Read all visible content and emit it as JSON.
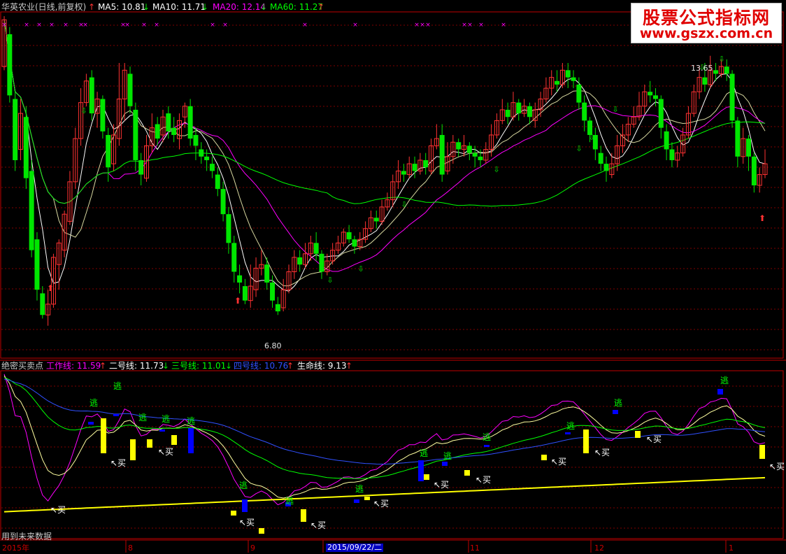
{
  "colors": {
    "up": "#ff3232",
    "down": "#00e600",
    "ma5": "#ffffff",
    "ma10": "#ffff00",
    "ma20": "#ff00ff",
    "ma60": "#00ff00",
    "grid": "#800000",
    "border": "#c00000",
    "blue": "#0000ff",
    "yellow": "#ffff00",
    "escape": "#00ff00"
  },
  "top_bar": {
    "title": "华英农业(日线,前复权)",
    "ma5": "MA5: 10.81",
    "ma10": "MA10: 11.71",
    "ma20": "MA20: 12.14",
    "ma60": "MA60: 11.27"
  },
  "bottom_bar": {
    "title": "绝密买卖点",
    "l1": "工作线: 11.59",
    "l2": "二号线: 11.73",
    "l3": "三号线: 11.01",
    "l4": "四号线: 10.76",
    "l5": "生命线: 9.13"
  },
  "arrows": {
    "up": "↑",
    "down": "↓"
  },
  "watermark": {
    "line1": "股票公式指标网",
    "line2": "www.gszx.com.cn"
  },
  "price_labels": {
    "high": "13.65",
    "low": "6.80"
  },
  "footer_note": "用到未来数据",
  "x_labels": [
    {
      "text": "2015年"
    },
    {
      "text": "8"
    },
    {
      "text": "9"
    },
    {
      "text": "2015/09/22/二"
    },
    {
      "text": "11"
    },
    {
      "text": "12"
    },
    {
      "text": "1"
    }
  ],
  "signal_text": {
    "escape": "逃",
    "buy": "买"
  },
  "chart_data": {
    "type": "candlestick",
    "top_axis": {
      "ylim": [
        5.4,
        15.0
      ],
      "grid": true
    },
    "bottom_axis": {
      "ylim": [
        5.5,
        15.5
      ],
      "grid": true
    },
    "candles": [
      [
        13.5,
        14.8,
        14.9,
        13.4
      ],
      [
        14.4,
        12.7,
        14.6,
        12.5
      ],
      [
        12.6,
        10.9,
        12.8,
        10.6
      ],
      [
        11.2,
        12.2,
        12.6,
        10.9
      ],
      [
        12.1,
        10.4,
        12.4,
        10.1
      ],
      [
        10.6,
        8.4,
        10.9,
        8.2
      ],
      [
        8.7,
        7.3,
        8.9,
        7.0
      ],
      [
        7.2,
        6.6,
        7.4,
        6.5
      ],
      [
        6.6,
        6.9,
        7.3,
        6.3
      ],
      [
        6.9,
        8.2,
        8.3,
        6.8
      ],
      [
        8.0,
        8.6,
        8.7,
        7.3
      ],
      [
        8.4,
        9.4,
        9.5,
        8.2
      ],
      [
        9.2,
        10.3,
        10.6,
        9.1
      ],
      [
        10.3,
        11.5,
        11.8,
        10.1
      ],
      [
        11.5,
        12.5,
        12.9,
        11.3
      ],
      [
        12.5,
        13.1,
        13.3,
        12.4
      ],
      [
        13.2,
        12.2,
        13.4,
        12.0
      ],
      [
        12.2,
        12.6,
        12.8,
        11.8
      ],
      [
        12.6,
        11.7,
        12.7,
        11.5
      ],
      [
        11.6,
        10.7,
        11.8,
        10.3
      ],
      [
        10.8,
        11.6,
        11.9,
        10.6
      ],
      [
        11.5,
        12.6,
        13.6,
        11.3
      ],
      [
        12.6,
        13.4,
        13.6,
        12.0
      ],
      [
        13.3,
        12.4,
        13.5,
        12.2
      ],
      [
        12.3,
        10.9,
        12.5,
        10.6
      ],
      [
        10.9,
        10.5,
        11.1,
        10.2
      ],
      [
        10.4,
        11.3,
        11.6,
        10.3
      ],
      [
        11.3,
        11.8,
        12.2,
        11.1
      ],
      [
        11.9,
        11.5,
        12.1,
        11.3
      ],
      [
        11.6,
        12.1,
        12.3,
        11.4
      ],
      [
        12.2,
        11.7,
        12.4,
        11.5
      ],
      [
        11.8,
        11.6,
        12.1,
        11.4
      ],
      [
        11.5,
        12.0,
        12.2,
        11.2
      ],
      [
        12.1,
        12.4,
        12.5,
        11.8
      ],
      [
        12.4,
        11.5,
        12.6,
        11.3
      ],
      [
        11.6,
        11.3,
        11.8,
        10.9
      ],
      [
        11.2,
        11.0,
        11.4,
        10.8
      ],
      [
        11.0,
        10.9,
        11.2,
        10.6
      ],
      [
        10.8,
        10.6,
        11.0,
        10.4
      ],
      [
        10.5,
        10.1,
        10.7,
        9.9
      ],
      [
        10.1,
        9.4,
        10.3,
        9.2
      ],
      [
        9.4,
        8.6,
        9.6,
        8.3
      ],
      [
        8.6,
        7.8,
        8.8,
        7.5
      ],
      [
        7.7,
        7.5,
        8.0,
        7.2
      ],
      [
        7.4,
        7.0,
        7.6,
        6.9
      ],
      [
        7.0,
        7.4,
        8.0,
        6.8
      ],
      [
        7.3,
        7.9,
        8.2,
        7.1
      ],
      [
        7.9,
        8.0,
        8.4,
        7.7
      ],
      [
        8.0,
        7.5,
        8.2,
        7.3
      ],
      [
        7.5,
        7.0,
        7.7,
        6.8
      ],
      [
        6.9,
        6.7,
        7.1,
        6.6
      ],
      [
        6.8,
        7.3,
        7.6,
        6.7
      ],
      [
        7.3,
        7.8,
        8.0,
        7.2
      ],
      [
        7.8,
        8.2,
        8.4,
        7.6
      ],
      [
        8.2,
        8.0,
        8.4,
        7.8
      ],
      [
        8.0,
        8.3,
        8.6,
        7.9
      ],
      [
        8.3,
        8.6,
        8.8,
        8.1
      ],
      [
        8.6,
        8.3,
        8.9,
        8.1
      ],
      [
        8.3,
        7.8,
        8.4,
        7.6
      ],
      [
        7.8,
        8.1,
        8.3,
        7.7
      ],
      [
        8.1,
        8.4,
        8.6,
        8.0
      ],
      [
        8.4,
        8.6,
        8.8,
        8.3
      ],
      [
        8.6,
        8.9,
        9.0,
        8.5
      ],
      [
        8.9,
        8.7,
        9.1,
        8.6
      ],
      [
        8.7,
        8.5,
        8.8,
        8.3
      ],
      [
        8.5,
        8.7,
        8.9,
        8.4
      ],
      [
        8.7,
        9.0,
        9.2,
        8.6
      ],
      [
        9.0,
        9.3,
        9.5,
        8.9
      ],
      [
        9.3,
        9.2,
        9.5,
        9.0
      ],
      [
        9.2,
        9.6,
        9.8,
        9.1
      ],
      [
        9.6,
        9.8,
        10.0,
        9.5
      ],
      [
        9.8,
        10.3,
        10.5,
        9.6
      ],
      [
        10.3,
        10.6,
        10.9,
        10.1
      ],
      [
        10.6,
        10.5,
        10.8,
        10.3
      ],
      [
        10.5,
        10.8,
        11.0,
        10.4
      ],
      [
        10.8,
        10.6,
        11.0,
        10.4
      ],
      [
        10.6,
        10.9,
        11.1,
        10.5
      ],
      [
        10.9,
        10.7,
        11.1,
        10.5
      ],
      [
        10.6,
        11.3,
        11.5,
        10.5
      ],
      [
        11.3,
        11.5,
        11.9,
        11.2
      ],
      [
        11.6,
        10.5,
        11.9,
        10.3
      ],
      [
        10.6,
        11.0,
        11.4,
        10.5
      ],
      [
        11.0,
        11.4,
        11.6,
        10.8
      ],
      [
        11.4,
        11.2,
        11.5,
        11.0
      ],
      [
        11.2,
        11.3,
        11.6,
        11.0
      ],
      [
        11.3,
        11.1,
        11.4,
        10.9
      ],
      [
        11.1,
        11.0,
        11.3,
        10.7
      ],
      [
        11.0,
        10.9,
        11.2,
        10.7
      ],
      [
        10.9,
        11.2,
        11.4,
        10.8
      ],
      [
        11.2,
        11.6,
        11.9,
        11.0
      ],
      [
        11.6,
        12.0,
        12.2,
        11.5
      ],
      [
        12.0,
        12.3,
        12.6,
        11.9
      ],
      [
        12.3,
        12.1,
        12.5,
        11.9
      ],
      [
        12.1,
        12.5,
        12.8,
        12.0
      ],
      [
        12.5,
        12.2,
        12.6,
        12.0
      ],
      [
        12.2,
        12.4,
        12.6,
        12.1
      ],
      [
        12.4,
        12.1,
        12.5,
        11.9
      ],
      [
        12.0,
        12.3,
        12.5,
        11.8
      ],
      [
        12.3,
        12.6,
        12.8,
        12.1
      ],
      [
        12.6,
        12.9,
        13.2,
        12.5
      ],
      [
        12.9,
        13.2,
        13.4,
        12.7
      ],
      [
        13.1,
        13.0,
        13.4,
        12.8
      ],
      [
        13.0,
        13.4,
        13.6,
        12.9
      ],
      [
        13.4,
        13.2,
        13.6,
        12.9
      ],
      [
        13.2,
        13.1,
        13.4,
        12.9
      ],
      [
        13.0,
        12.5,
        13.2,
        12.3
      ],
      [
        12.5,
        12.0,
        12.7,
        11.7
      ],
      [
        12.0,
        11.6,
        12.1,
        11.4
      ],
      [
        11.6,
        11.2,
        11.8,
        10.9
      ],
      [
        11.1,
        10.8,
        11.3,
        10.6
      ],
      [
        10.8,
        10.6,
        11.0,
        10.3
      ],
      [
        10.5,
        10.8,
        11.1,
        10.4
      ],
      [
        10.8,
        11.3,
        11.6,
        10.6
      ],
      [
        11.3,
        11.6,
        11.9,
        11.1
      ],
      [
        11.6,
        11.9,
        12.1,
        11.4
      ],
      [
        11.9,
        12.1,
        12.4,
        11.8
      ],
      [
        12.1,
        12.4,
        12.8,
        12.0
      ],
      [
        12.4,
        12.8,
        13.0,
        12.2
      ],
      [
        12.8,
        12.7,
        13.1,
        12.5
      ],
      [
        12.7,
        12.6,
        12.9,
        12.4
      ],
      [
        12.6,
        11.8,
        12.7,
        11.5
      ],
      [
        11.7,
        11.2,
        11.9,
        10.9
      ],
      [
        11.2,
        10.9,
        11.4,
        10.7
      ],
      [
        10.9,
        11.1,
        11.3,
        10.7
      ],
      [
        11.1,
        11.6,
        11.8,
        11.0
      ],
      [
        11.6,
        12.2,
        12.4,
        11.5
      ],
      [
        12.2,
        12.8,
        13.0,
        12.1
      ],
      [
        12.8,
        13.2,
        13.5,
        12.6
      ],
      [
        13.2,
        13.0,
        13.6,
        12.8
      ],
      [
        13.0,
        13.4,
        13.8,
        12.9
      ],
      [
        13.4,
        13.3,
        13.6,
        13.1
      ],
      [
        13.3,
        13.5,
        13.7,
        13.2
      ],
      [
        13.5,
        13.3,
        13.7,
        13.1
      ],
      [
        13.3,
        12.0,
        13.4,
        11.8
      ],
      [
        12.0,
        11.0,
        12.1,
        10.7
      ],
      [
        11.0,
        11.5,
        11.8,
        10.8
      ],
      [
        11.5,
        11.0,
        11.6,
        10.6
      ],
      [
        11.0,
        10.2,
        11.1,
        10.0
      ],
      [
        10.2,
        10.5,
        10.7,
        10.0
      ],
      [
        10.5,
        10.8,
        11.2,
        10.4
      ]
    ],
    "bottom_lines": [
      "工作线",
      "二号线",
      "三号线",
      "四号线",
      "生命线"
    ]
  }
}
